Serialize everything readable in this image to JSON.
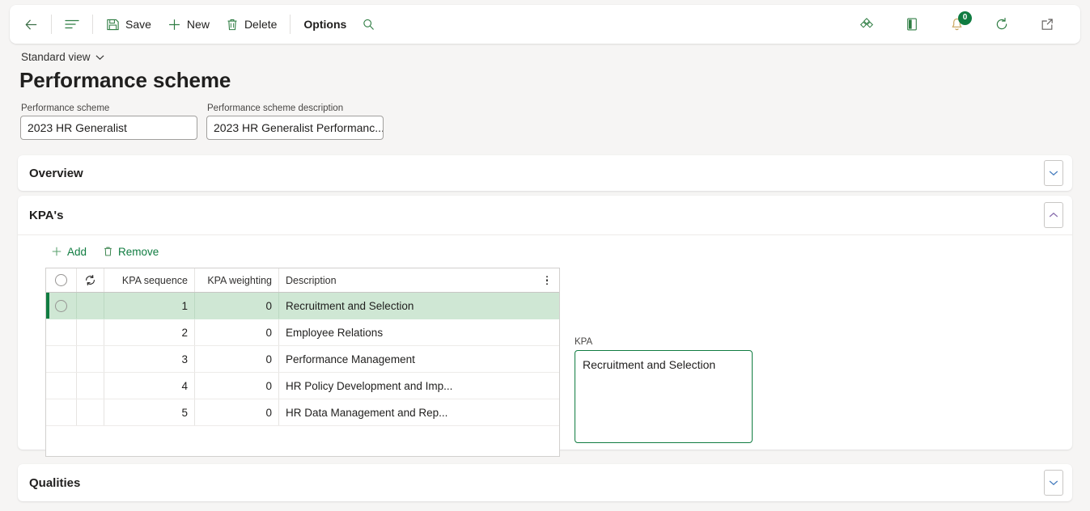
{
  "toolbar": {
    "back_label": "",
    "show_list_label": "",
    "save_label": "Save",
    "new_label": "New",
    "delete_label": "Delete",
    "options_label": "Options",
    "search_label": "",
    "notification_count": "0",
    "accent_color": "#107c41"
  },
  "header": {
    "view_selector": "Standard view",
    "page_title": "Performance scheme"
  },
  "fields": [
    {
      "label": "Performance scheme",
      "value": "2023 HR Generalist"
    },
    {
      "label": "Performance scheme description",
      "value": "2023 HR Generalist Performanc..."
    }
  ],
  "sections": {
    "overview": {
      "title": "Overview",
      "expanded": false
    },
    "kpas": {
      "title": "KPA's",
      "expanded": true
    },
    "qualities": {
      "title": "Qualities",
      "expanded": false
    }
  },
  "grid_toolbar": {
    "add_label": "Add",
    "remove_label": "Remove"
  },
  "grid": {
    "columns": [
      "",
      "",
      "KPA sequence",
      "KPA weighting",
      "Description"
    ],
    "rows": [
      {
        "sequence": "1",
        "weighting": "0",
        "description": "Recruitment and Selection",
        "selected": true
      },
      {
        "sequence": "2",
        "weighting": "0",
        "description": "Employee Relations",
        "selected": false
      },
      {
        "sequence": "3",
        "weighting": "0",
        "description": "Performance Management",
        "selected": false
      },
      {
        "sequence": "4",
        "weighting": "0",
        "description": "HR Policy Development and Imp...",
        "selected": false
      },
      {
        "sequence": "5",
        "weighting": "0",
        "description": "HR Data Management and Rep...",
        "selected": false
      }
    ]
  },
  "detail": {
    "label": "KPA",
    "value": "Recruitment and Selection"
  }
}
